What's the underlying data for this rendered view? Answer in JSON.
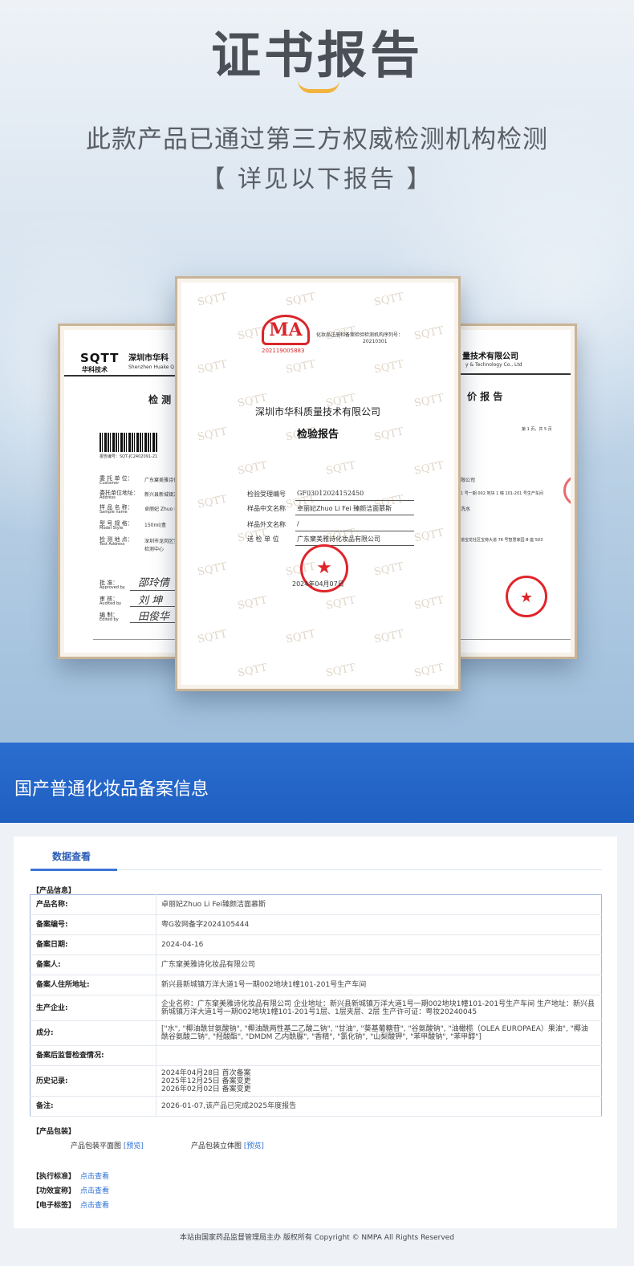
{
  "hero": {
    "title": "证书报告",
    "subtitle": "此款产品已通过第三方权威检测机构检测",
    "subtitle2": "【 详见以下报告 】",
    "accent_color": "#f2b33d"
  },
  "left_doc": {
    "logo": "SQTT",
    "logo_sub": "华科技术",
    "company": "深圳市华科",
    "company_en": "Shenzhen Huake Q",
    "heading": "检 测",
    "report_no": "报告编号：SQT-JC2402091-21",
    "rows": [
      {
        "label": "委 托 单 位：",
        "label_en": "Customer",
        "value": "广东窠美雅诗化"
      },
      {
        "label": "委托单位地址：",
        "label_en": "Address",
        "value": "新兴县新城镇万"
      },
      {
        "label": "样 品 名 称：",
        "label_en": "Sample name",
        "value": "卓丽妃 Zhuo Li Fe"
      },
      {
        "label": "型 号 规 格：",
        "label_en": "Model Style",
        "value": "150ml/盒"
      },
      {
        "label": "检 测 地 点：",
        "label_en": "Test Address",
        "value": "深圳市龙岗区宝"
      }
    ],
    "test_center": "检测中心",
    "signers": [
      {
        "label": "批 准：",
        "label_en": "Approved by",
        "sign": "邵玲倩"
      },
      {
        "label": "审 核：",
        "label_en": "Audited by",
        "sign": "刘 坤"
      },
      {
        "label": "编 制：",
        "label_en": "Edited by",
        "sign": "田俊华"
      }
    ]
  },
  "right_doc": {
    "company": "量技术有限公司",
    "company_en": "y & Technology Co., Ltd",
    "heading": "价 报 告",
    "page": "第 1 页，共 5 页",
    "line1": "限公司",
    "line2": "1 号一期 002 地块 1 幢 101-201 号生产车间",
    "line3": "洗水",
    "line4": "道宝龙社区宝荷大道 76 号智慧家园 B 座 503"
  },
  "center_doc": {
    "watermark": "SQTT",
    "ma_text": "MA",
    "ma_number": "202119005883",
    "approval_text": "化妆品注册和备案检验检测机构序列号：",
    "approval_no": "20210301",
    "company": "深圳市华科质量技术有限公司",
    "title": "检验报告",
    "fields": [
      {
        "label": "检验受理编号",
        "value": "GF03012024152450"
      },
      {
        "label": "样品中文名称",
        "value": "卓丽妃Zhuo Li Fei 臻颜洁面慕斯"
      },
      {
        "label": "样品外文名称",
        "value": "/"
      },
      {
        "label": "送 检 单 位",
        "value": "广东窠美雅诗化妆品有限公司"
      }
    ],
    "date": "2024年04月07日",
    "stamp_color": "#e0242a"
  },
  "banner": {
    "title": "国产普通化妆品备案信息",
    "color": "#1f5fc0"
  },
  "panel": {
    "tab": "数据查看",
    "section_info": "【产品信息】",
    "rows": [
      {
        "key": "产品名称:",
        "value": "卓丽妃Zhuo Li Fei臻颜洁面慕斯"
      },
      {
        "key": "备案编号:",
        "value": "粤G妆网备字2024105444"
      },
      {
        "key": "备案日期:",
        "value": "2024-04-16"
      },
      {
        "key": "备案人:",
        "value": "广东窠美雅诗化妆品有限公司"
      },
      {
        "key": "备案人住所地址:",
        "value": "新兴县新城镇万洋大道1号一期002地块1幢101-201号生产车间"
      },
      {
        "key": "生产企业:",
        "value": "企业名称：广东窠美雅诗化妆品有限公司 企业地址：新兴县新城镇万洋大道1号一期002地块1幢101-201号生产车间 生产地址：新兴县新城镇万洋大道1号一期002地块1幢101-201号1层、1层夹层、2层 生产许可证：粤妆20240045"
      },
      {
        "key": "成分:",
        "value": "[\"水\", \"椰油酰甘氨酸钠\", \"椰油酰两性基二乙酸二钠\", \"甘油\", \"葵基葡糖苷\", \"谷氨酸钠\", \"油橄榄（OLEA EUROPAEA）果油\", \"椰油酰谷氨酸二钠\", \"羟酸酯\", \"DMDM 乙内酰脲\", \"香精\", \"氯化钠\", \"山梨酸钾\", \"苯甲酸钠\", \"苯甲醇\"]"
      },
      {
        "key": "备案后监督检查情况:",
        "value": ""
      },
      {
        "key": "历史记录:",
        "value": "2024年04月28日 首次备案\n2025年12月25日 备案变更\n2026年02月02日 备案变更"
      },
      {
        "key": "备注:",
        "value": "2026-01-07,该产品已完成2025年度报告"
      }
    ],
    "section_pkg": "【产品包装】",
    "pkg_flat": "产品包装平面图",
    "pkg_3d": "产品包装立体图",
    "preview": "[预览]",
    "standards": [
      {
        "label": "【执行标准】",
        "link": "点击查看"
      },
      {
        "label": "【功效宣称】",
        "link": "点击查看"
      },
      {
        "label": "【电子标签】",
        "link": "点击查看"
      }
    ]
  },
  "footer": "本站由国家药品监督管理局主办 版权所有 Copyright © NMPA All Rights Reserved"
}
